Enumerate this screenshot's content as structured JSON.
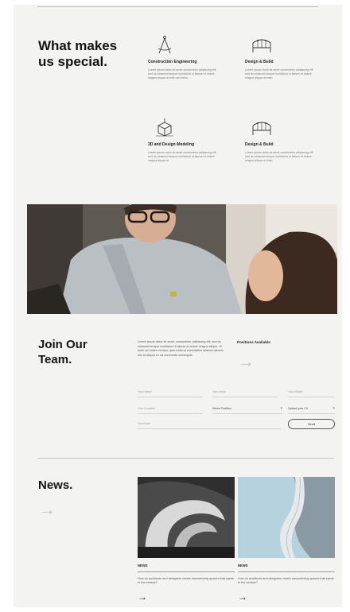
{
  "special": {
    "title": "What makes us special.",
    "features": [
      {
        "icon": "drafting-compass-icon",
        "title": "Construction Engineering",
        "desc": "Lorem ipsum dolor sit amet consectetur adipiscing elit sed do eiusmod tempor incididunt ut labore et dolore magna aliqua ut enim ad minim."
      },
      {
        "icon": "bridge-icon",
        "title": "Design & Build",
        "desc": "Lorem ipsum dolor sit amet consectetur adipiscing elit sed do eiusmod tempor incididunt ut labore et dolore magna aliqua ut enim."
      },
      {
        "icon": "cube-model-icon",
        "title": "3D and Design Modeling",
        "desc": "Lorem ipsum dolor sit amet consectetur adipiscing elit sed do eiusmod tempor incididunt ut labore et dolore magna aliqua ut."
      },
      {
        "icon": "bridge-icon",
        "title": "Design & Build",
        "desc": "Lorem ipsum dolor sit amet consectetur adipiscing elit sed do eiusmod tempor incididunt ut labore et dolore magna aliqua ut enim."
      }
    ]
  },
  "join": {
    "title": "Join Our Team.",
    "text": "Lorem ipsum dolor sit amet, consectetur adipiscing elit, sed do eiusmod tempor incididunt ut labore et dolore magna aliqua. Ut enim ad minim veniam, quis nostrud exercitation ullamco laboris nisi ut aliquip ex ea commodo consequat.",
    "positions_label": "Positions Available",
    "arrow": "→",
    "fields": {
      "name": "Your Name",
      "email": "Your email",
      "phone": "Your Mobile",
      "location": "Your Location",
      "position": "Select Position",
      "cv": "Upload your CV",
      "message": "Your Note"
    },
    "send_label": "Send"
  },
  "news": {
    "title": "News.",
    "arrow": "→",
    "cards": [
      {
        "tag": "NEWS",
        "text": "How do architects and designers create mesmerizing spaces that speak to the senses?",
        "arrow": "→"
      },
      {
        "tag": "NEWS",
        "text": "How do architects and designers create mesmerizing spaces that speak to the senses?",
        "arrow": "→"
      }
    ]
  },
  "colors": {
    "background": "#f3f3f1",
    "text": "#141414",
    "accent_arrow": "#c4c4c4"
  }
}
